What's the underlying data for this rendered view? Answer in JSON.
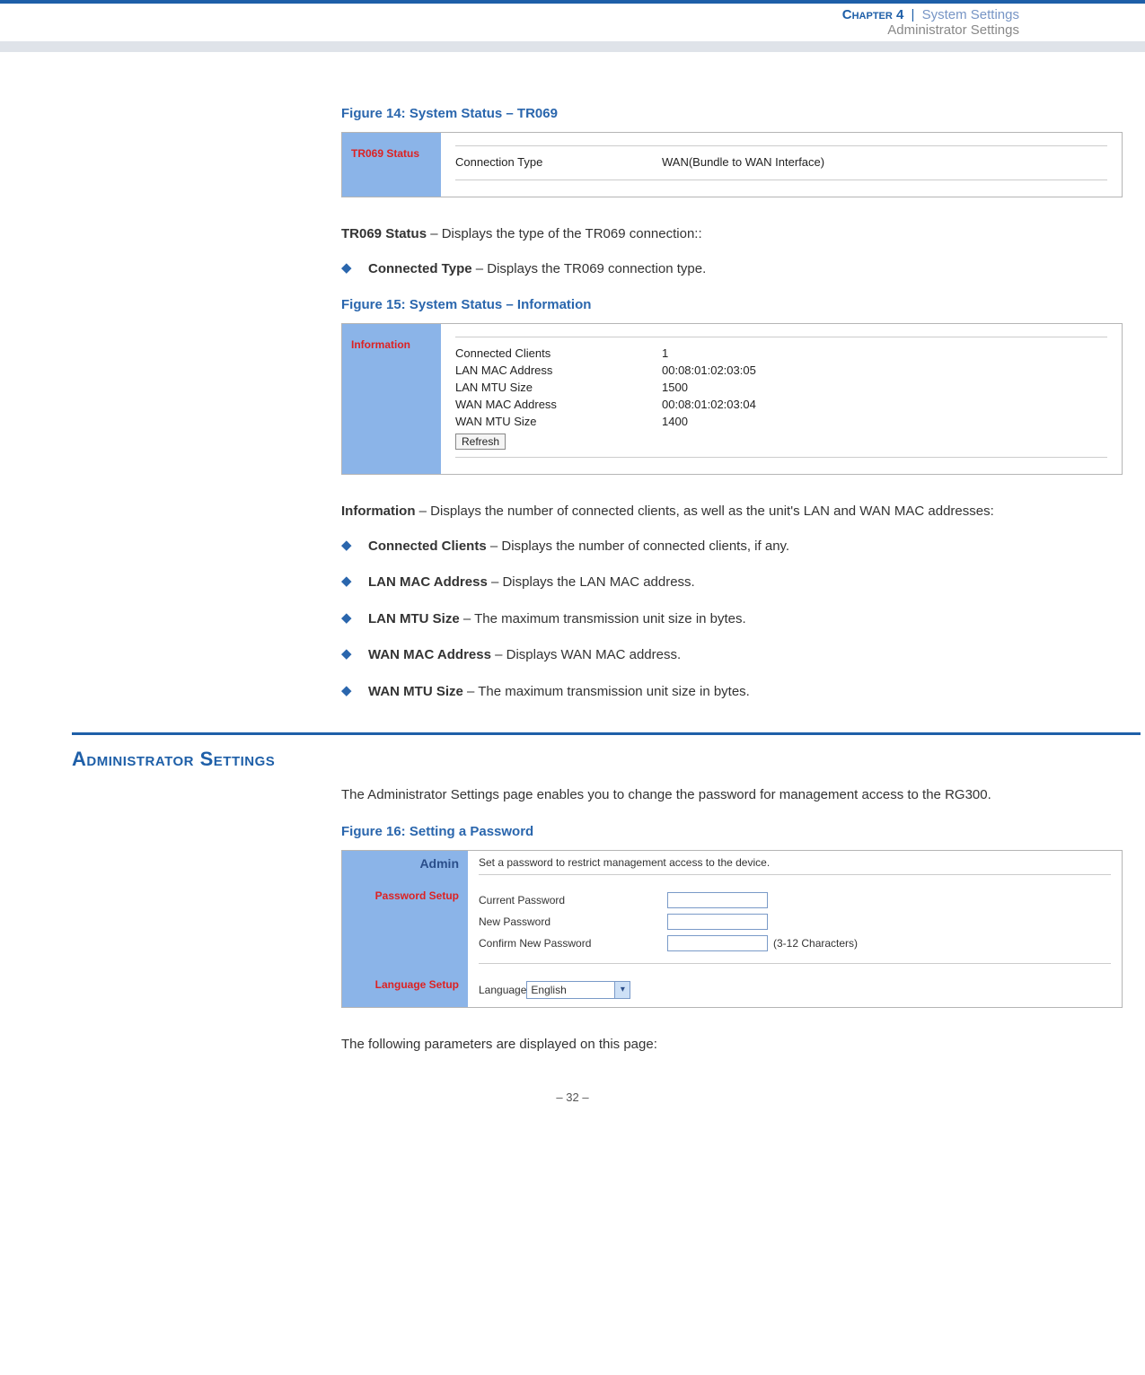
{
  "header": {
    "chapter_label": "Chapter 4",
    "sep": "|",
    "section": "System Settings",
    "subsection": "Administrator Settings"
  },
  "fig14": {
    "caption": "Figure 14:  System Status – TR069",
    "side_label": "TR069 Status",
    "row_key": "Connection Type",
    "row_val": "WAN(Bundle to WAN Interface)"
  },
  "tr069_text": {
    "lead": "TR069 Status",
    "rest": " – Displays the type of the TR069 connection::"
  },
  "tr069_bullet": {
    "lead": "Connected Type",
    "rest": " – Displays the TR069 connection type."
  },
  "fig15": {
    "caption": "Figure 15:  System Status – Information",
    "side_label": "Information",
    "rows": [
      {
        "k": "Connected Clients",
        "v": "1"
      },
      {
        "k": "LAN MAC Address",
        "v": "00:08:01:02:03:05"
      },
      {
        "k": "LAN MTU Size",
        "v": "1500"
      },
      {
        "k": "WAN MAC Address",
        "v": "00:08:01:02:03:04"
      },
      {
        "k": "WAN MTU Size",
        "v": "1400"
      }
    ],
    "refresh": "Refresh"
  },
  "info_text": {
    "lead": "Information",
    "rest": " – Displays the number of connected clients, as well as the unit's LAN and WAN MAC addresses:"
  },
  "info_bullets": [
    {
      "lead": "Connected Clients",
      "rest": " – Displays the number of connected clients, if any."
    },
    {
      "lead": "LAN MAC Address",
      "rest": " – Displays the LAN MAC address."
    },
    {
      "lead": "LAN MTU Size",
      "rest": " – The maximum transmission unit size in bytes."
    },
    {
      "lead": "WAN MAC Address",
      "rest": " – Displays WAN MAC address."
    },
    {
      "lead": "WAN MTU Size",
      "rest": " – The maximum transmission unit size in bytes."
    }
  ],
  "section_heading": "Administrator Settings",
  "admin_intro": "The Administrator Settings page enables you to change the password for management access to the RG300.",
  "fig16": {
    "caption": "Figure 16:  Setting a Password",
    "admin_label": "Admin",
    "pw_label": "Password Setup",
    "lang_label": "Language Setup",
    "desc": "Set a password to restrict management access to the device.",
    "current": "Current Password",
    "new": "New Password",
    "confirm": "Confirm New Password",
    "note": "(3-12 Characters)",
    "lang_key": "Language",
    "lang_val": "English"
  },
  "closing": "The following parameters are displayed on this page:",
  "page_number": "–  32  –"
}
